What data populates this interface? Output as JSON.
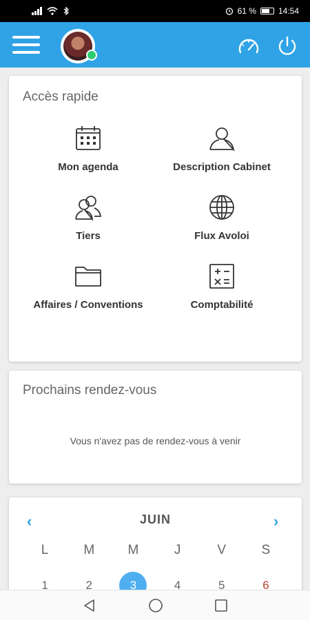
{
  "status_bar": {
    "battery": "61 %",
    "time": "14:54"
  },
  "colors": {
    "primary": "#2fa3e6",
    "today": "#4eaef0",
    "sunday": "#b3442f",
    "online": "#2ecc71"
  },
  "quick_access": {
    "title": "Accès rapide",
    "items": [
      {
        "label": "Mon agenda",
        "icon": "calendar-icon"
      },
      {
        "label": "Description Cabinet",
        "icon": "person-icon"
      },
      {
        "label": "Tiers",
        "icon": "people-icon"
      },
      {
        "label": "Flux Avoloi",
        "icon": "globe-icon"
      },
      {
        "label": "Affaires / Conventions",
        "icon": "folder-icon"
      },
      {
        "label": "Comptabilité",
        "icon": "calculator-icon"
      }
    ]
  },
  "appointments": {
    "title": "Prochains rendez-vous",
    "empty_message": "Vous n'avez pas de rendez-vous à venir"
  },
  "calendar": {
    "month": "JUIN",
    "weekdays": [
      "L",
      "M",
      "M",
      "J",
      "V",
      "S"
    ],
    "days": [
      "1",
      "2",
      "3",
      "4",
      "5",
      "6"
    ],
    "today": "3"
  }
}
